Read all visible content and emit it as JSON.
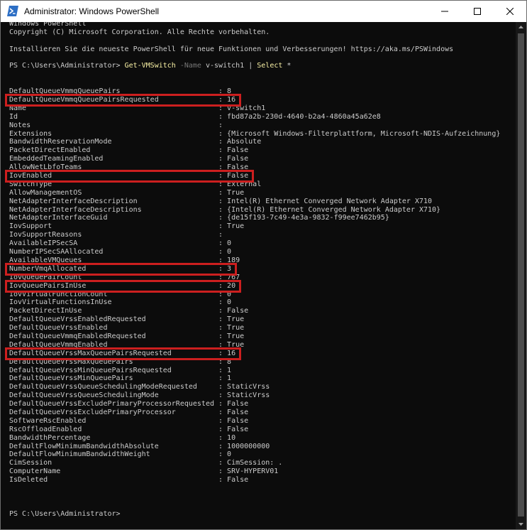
{
  "window": {
    "title": "Administrator: Windows PowerShell",
    "controls": {
      "minimize": "minimize",
      "maximize": "maximize",
      "close": "close"
    }
  },
  "console": {
    "header": [
      "Windows PowerShell",
      "Copyright (C) Microsoft Corporation. Alle Rechte vorbehalten.",
      "",
      "Installieren Sie die neueste PowerShell für neue Funktionen und Verbesserungen! https://aka.ms/PSWindows",
      ""
    ],
    "command": {
      "prompt": "PS C:\\Users\\Administrator> ",
      "cmdlet": "Get-VMSwitch",
      "param_name": "-Name",
      "param_value": "v-switch1",
      "pipe": "|",
      "pipe_cmdlet": "Select",
      "pipe_arg": "*"
    },
    "properties": [
      {
        "name": "DefaultQueueVmmqQueuePairs",
        "value": "8",
        "highlighted": false
      },
      {
        "name": "DefaultQueueVmmqQueuePairsRequested",
        "value": "16",
        "highlighted": true
      },
      {
        "name": "Name",
        "value": "v-switch1",
        "highlighted": false
      },
      {
        "name": "Id",
        "value": "fbd87a2b-230d-4640-b2a4-4860a45a62e8",
        "highlighted": false
      },
      {
        "name": "Notes",
        "value": "",
        "highlighted": false
      },
      {
        "name": "Extensions",
        "value": "{Microsoft Windows-Filterplattform, Microsoft-NDIS-Aufzeichnung}",
        "highlighted": false
      },
      {
        "name": "BandwidthReservationMode",
        "value": "Absolute",
        "highlighted": false
      },
      {
        "name": "PacketDirectEnabled",
        "value": "False",
        "highlighted": false
      },
      {
        "name": "EmbeddedTeamingEnabled",
        "value": "False",
        "highlighted": false
      },
      {
        "name": "AllowNetLbfoTeams",
        "value": "False",
        "highlighted": false
      },
      {
        "name": "IovEnabled",
        "value": "False",
        "highlighted": true
      },
      {
        "name": "SwitchType",
        "value": "External",
        "highlighted": false
      },
      {
        "name": "AllowManagementOS",
        "value": "True",
        "highlighted": false
      },
      {
        "name": "NetAdapterInterfaceDescription",
        "value": "Intel(R) Ethernet Converged Network Adapter X710",
        "highlighted": false
      },
      {
        "name": "NetAdapterInterfaceDescriptions",
        "value": "{Intel(R) Ethernet Converged Network Adapter X710}",
        "highlighted": false
      },
      {
        "name": "NetAdapterInterfaceGuid",
        "value": "{de15f193-7c49-4e3a-9832-f99ee7462b95}",
        "highlighted": false
      },
      {
        "name": "IovSupport",
        "value": "True",
        "highlighted": false
      },
      {
        "name": "IovSupportReasons",
        "value": "",
        "highlighted": false
      },
      {
        "name": "AvailableIPSecSA",
        "value": "0",
        "highlighted": false
      },
      {
        "name": "NumberIPSecSAAllocated",
        "value": "0",
        "highlighted": false
      },
      {
        "name": "AvailableVMQueues",
        "value": "189",
        "highlighted": false
      },
      {
        "name": "NumberVmqAllocated",
        "value": "3",
        "highlighted": true
      },
      {
        "name": "IovQueuePairCount",
        "value": "767",
        "highlighted": false
      },
      {
        "name": "IovQueuePairsInUse",
        "value": "20",
        "highlighted": true
      },
      {
        "name": "IovVirtualFunctionCount",
        "value": "0",
        "highlighted": false
      },
      {
        "name": "IovVirtualFunctionsInUse",
        "value": "0",
        "highlighted": false
      },
      {
        "name": "PacketDirectInUse",
        "value": "False",
        "highlighted": false
      },
      {
        "name": "DefaultQueueVrssEnabledRequested",
        "value": "True",
        "highlighted": false
      },
      {
        "name": "DefaultQueueVrssEnabled",
        "value": "True",
        "highlighted": false
      },
      {
        "name": "DefaultQueueVmmqEnabledRequested",
        "value": "True",
        "highlighted": false
      },
      {
        "name": "DefaultQueueVmmqEnabled",
        "value": "True",
        "highlighted": false
      },
      {
        "name": "DefaultQueueVrssMaxQueuePairsRequested",
        "value": "16",
        "highlighted": true
      },
      {
        "name": "DefaultQueueVrssMaxQueuePairs",
        "value": "8",
        "highlighted": false
      },
      {
        "name": "DefaultQueueVrssMinQueuePairsRequested",
        "value": "1",
        "highlighted": false
      },
      {
        "name": "DefaultQueueVrssMinQueuePairs",
        "value": "1",
        "highlighted": false
      },
      {
        "name": "DefaultQueueVrssQueueSchedulingModeRequested",
        "value": "StaticVrss",
        "highlighted": false
      },
      {
        "name": "DefaultQueueVrssQueueSchedulingMode",
        "value": "StaticVrss",
        "highlighted": false
      },
      {
        "name": "DefaultQueueVrssExcludePrimaryProcessorRequested",
        "value": "False",
        "highlighted": false
      },
      {
        "name": "DefaultQueueVrssExcludePrimaryProcessor",
        "value": "False",
        "highlighted": false
      },
      {
        "name": "SoftwareRscEnabled",
        "value": "False",
        "highlighted": false
      },
      {
        "name": "RscOffloadEnabled",
        "value": "False",
        "highlighted": false
      },
      {
        "name": "BandwidthPercentage",
        "value": "10",
        "highlighted": false
      },
      {
        "name": "DefaultFlowMinimumBandwidthAbsolute",
        "value": "1000000000",
        "highlighted": false
      },
      {
        "name": "DefaultFlowMinimumBandwidthWeight",
        "value": "0",
        "highlighted": false
      },
      {
        "name": "CimSession",
        "value": "CimSession: .",
        "highlighted": false
      },
      {
        "name": "ComputerName",
        "value": "SRV-HYPERV01",
        "highlighted": false
      },
      {
        "name": "IsDeleted",
        "value": "False",
        "highlighted": false
      }
    ],
    "final_prompt": "PS C:\\Users\\Administrator>",
    "highlight_color": "#cc1f1f"
  }
}
